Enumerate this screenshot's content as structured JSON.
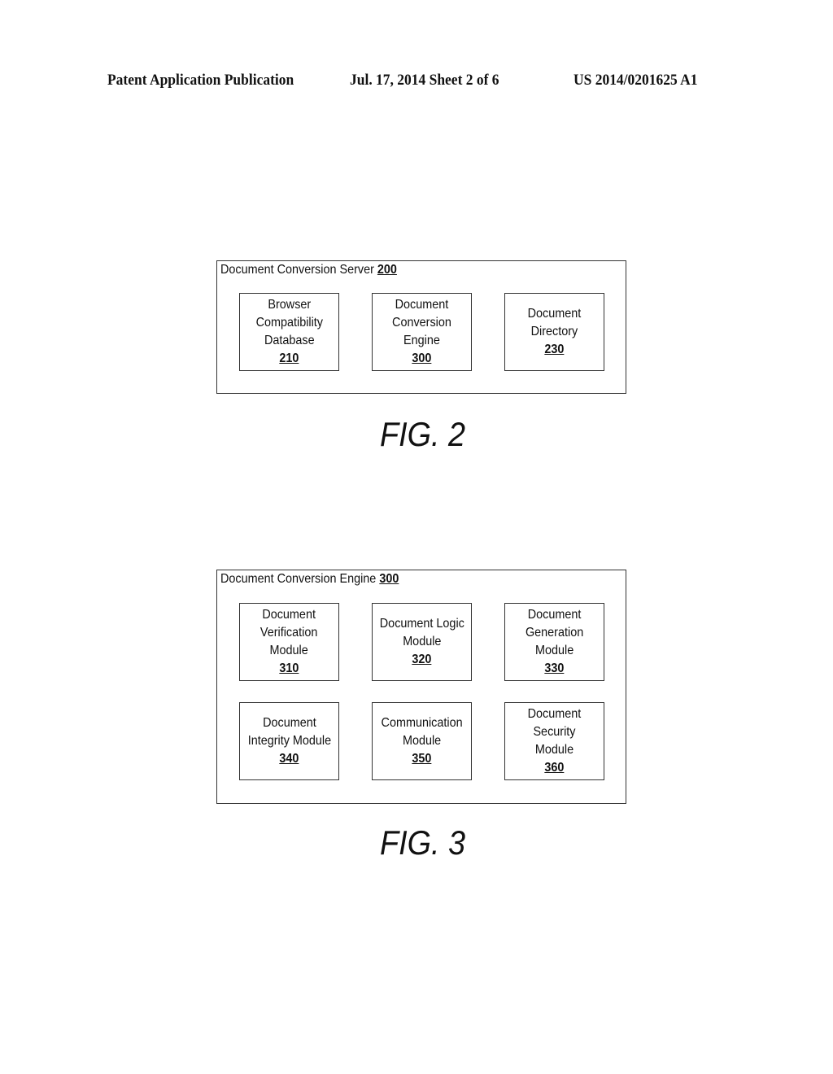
{
  "header": {
    "left": "Patent Application Publication",
    "middle": "Jul. 17, 2014   Sheet 2 of 6",
    "right": "US 2014/0201625 A1"
  },
  "fig2": {
    "container": {
      "title": "Document Conversion Server",
      "ref": "200"
    },
    "boxes": [
      {
        "label": "Browser\nCompatibility\nDatabase",
        "ref": "210"
      },
      {
        "label": "Document\nConversion\nEngine",
        "ref": "300"
      },
      {
        "label": "Document\nDirectory",
        "ref": "230"
      }
    ],
    "caption": "FIG. 2"
  },
  "fig3": {
    "container": {
      "title": "Document Conversion Engine",
      "ref": "300"
    },
    "boxes": [
      {
        "label": "Document\nVerification\nModule",
        "ref": "310"
      },
      {
        "label": "Document Logic\nModule",
        "ref": "320"
      },
      {
        "label": "Document\nGeneration\nModule",
        "ref": "330"
      },
      {
        "label": "Document\nIntegrity Module",
        "ref": "340"
      },
      {
        "label": "Communication\nModule",
        "ref": "350"
      },
      {
        "label": "Document\nSecurity\nModule",
        "ref": "360"
      }
    ],
    "caption": "FIG. 3"
  }
}
